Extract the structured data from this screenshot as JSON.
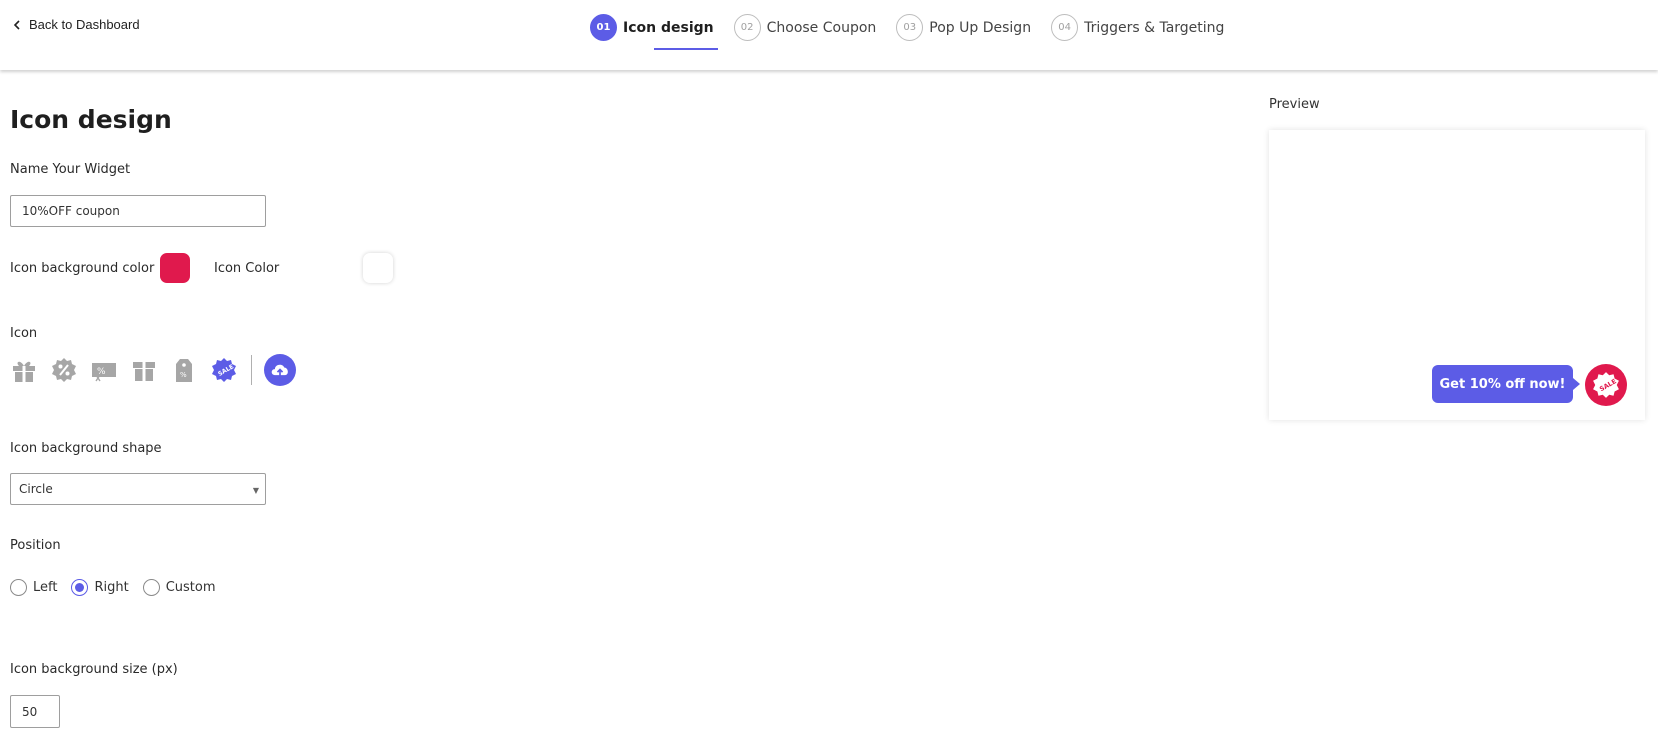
{
  "header": {
    "back_label": "Back to Dashboard",
    "steps": [
      {
        "num": "01",
        "label": "Icon design",
        "active": true
      },
      {
        "num": "02",
        "label": "Choose Coupon",
        "active": false
      },
      {
        "num": "03",
        "label": "Pop Up Design",
        "active": false
      },
      {
        "num": "04",
        "label": "Triggers & Targeting",
        "active": false
      }
    ]
  },
  "form": {
    "title": "Icon design",
    "widget_name_label": "Name Your Widget",
    "widget_name_value": "10%OFF coupon",
    "icon_bg_color_label": "Icon background color",
    "icon_bg_color": "#e0194d",
    "icon_color_label": "Icon Color",
    "icon_color": "#ffffff",
    "icon_label": "Icon",
    "icons": [
      "gift-icon",
      "percent-badge-icon",
      "percent-ticket-icon",
      "gift-box-icon",
      "price-tag-icon",
      "sale-badge-icon"
    ],
    "selected_icon": "sale-badge-icon",
    "upload_icon": "cloud-upload-icon",
    "shape_label": "Icon background shape",
    "shape_value": "Circle",
    "position_label": "Position",
    "positions": [
      {
        "label": "Left",
        "checked": false
      },
      {
        "label": "Right",
        "checked": true
      },
      {
        "label": "Custom",
        "checked": false
      }
    ],
    "size_label": "Icon background size (px)",
    "size_value": "50"
  },
  "preview": {
    "label": "Preview",
    "cta_text": "Get 10% off now!",
    "badge_text": "SALE"
  },
  "colors": {
    "accent": "#5c5ce6",
    "icon_bg": "#e0194d",
    "icon_grey": "#a6a6a6"
  }
}
